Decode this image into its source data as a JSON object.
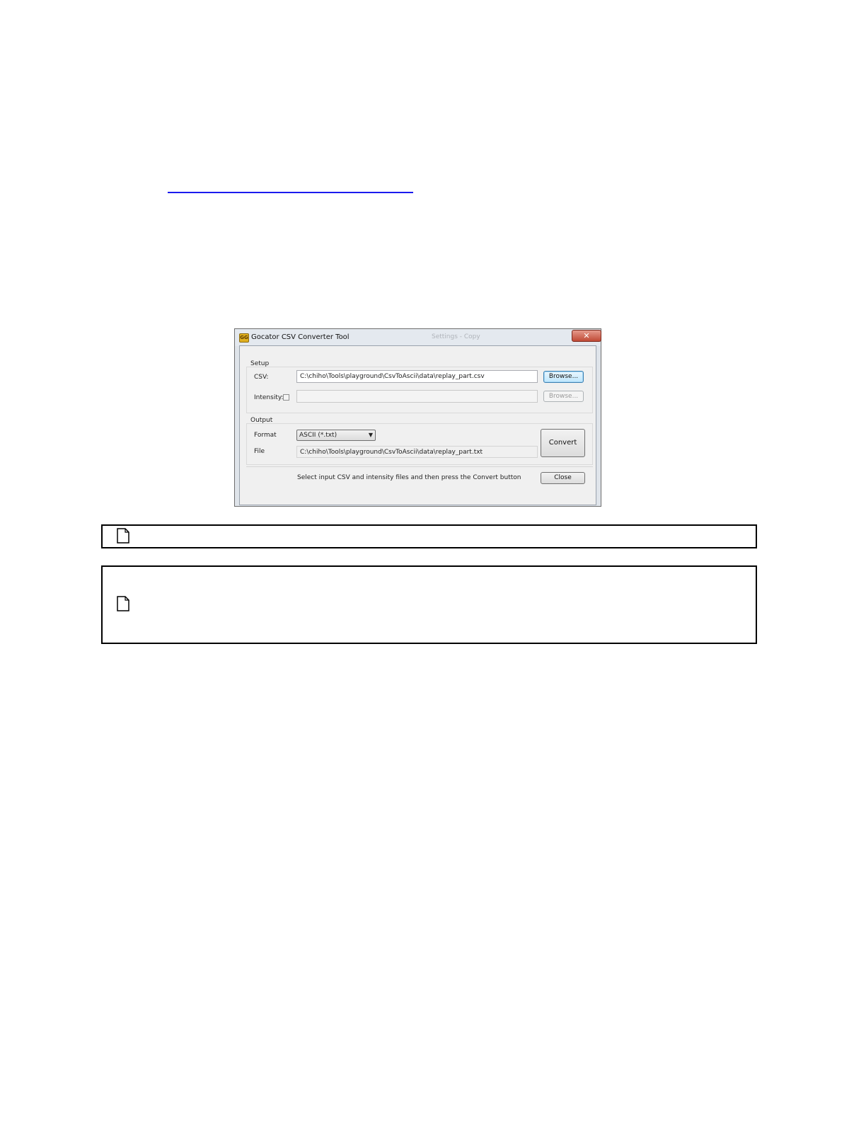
{
  "dialog": {
    "title": "Gocator CSV Converter Tool",
    "background_window_title": "Settings - Copy",
    "close_glyph": "✕",
    "setup": {
      "group_label": "Setup",
      "csv_label": "CSV:",
      "csv_value": "C:\\chiho\\Tools\\playground\\CsvToAscii\\data\\replay_part.csv",
      "csv_browse_label": "Browse...",
      "intensity_label": "Intensity:",
      "intensity_checked": false,
      "intensity_value": "",
      "intensity_browse_label": "Browse..."
    },
    "output": {
      "group_label": "Output",
      "format_label": "Format",
      "format_value": "ASCII (*.txt)",
      "file_label": "File",
      "file_value": "C:\\chiho\\Tools\\playground\\CsvToAscii\\data\\replay_part.txt",
      "convert_label": "Convert"
    },
    "status_text": "Select input CSV and intensity files and then press the Convert button",
    "close_label": "Close"
  },
  "notes": [
    {
      "icon": "note-icon"
    },
    {
      "icon": "note-icon"
    }
  ]
}
